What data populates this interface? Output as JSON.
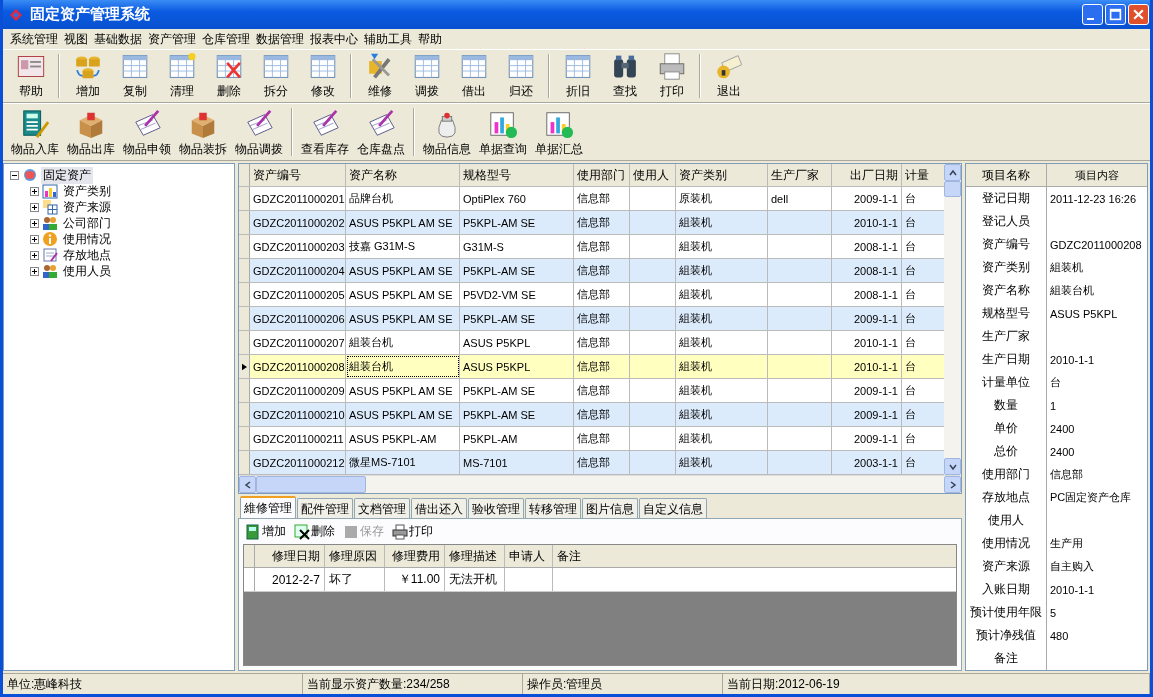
{
  "window": {
    "title": "固定资产管理系统"
  },
  "menu": [
    "系统管理",
    "视图",
    "基础数据",
    "资产管理",
    "仓库管理",
    "数据管理",
    "报表中心",
    "辅助工具",
    "帮助"
  ],
  "toolbar_main": [
    {
      "buttons": [
        "帮助"
      ]
    },
    {
      "buttons": [
        "增加",
        "复制",
        "清理",
        "删除",
        "拆分",
        "修改"
      ]
    },
    {
      "buttons": [
        "维修",
        "调拨",
        "借出",
        "归还"
      ]
    },
    {
      "buttons": [
        "折旧",
        "查找",
        "打印"
      ]
    },
    {
      "buttons": [
        "退出"
      ]
    }
  ],
  "toolbar_goods": [
    {
      "buttons": [
        "物品入库",
        "物品出库",
        "物品申领",
        "物品装拆",
        "物品调拨"
      ]
    },
    {
      "buttons": [
        "查看库存",
        "仓库盘点"
      ]
    },
    {
      "buttons": [
        "物品信息",
        "单据查询",
        "单据汇总"
      ]
    }
  ],
  "tree": [
    {
      "label": "固定资产",
      "expanded": true,
      "selected": true,
      "children": [
        {
          "label": "资产类别",
          "expanded": false,
          "selected": false
        },
        {
          "label": "资产来源",
          "expanded": false,
          "selected": false
        },
        {
          "label": "公司部门",
          "expanded": false,
          "selected": false
        },
        {
          "label": "使用情况",
          "expanded": false,
          "selected": false
        },
        {
          "label": "存放地点",
          "expanded": false,
          "selected": false
        },
        {
          "label": "使用人员",
          "expanded": false,
          "selected": false
        }
      ]
    }
  ],
  "table": {
    "columns": [
      "资产编号",
      "资产名称",
      "规格型号",
      "使用部门",
      "使用人",
      "资产类别",
      "生产厂家",
      "出厂日期",
      "计量"
    ],
    "rows": [
      {
        "selected": false,
        "cells": [
          "GDZC2011000201",
          "品牌台机",
          "OptiPlex 760",
          "信息部",
          "",
          "原装机",
          "dell",
          "2009-1-1",
          "台"
        ]
      },
      {
        "selected": false,
        "cells": [
          "GDZC2011000202",
          "ASUS P5KPL AM SE",
          "P5KPL-AM SE",
          "信息部",
          "",
          "組装机",
          "",
          "2010-1-1",
          "台"
        ]
      },
      {
        "selected": false,
        "cells": [
          "GDZC2011000203",
          "技嘉 G31M-S",
          "G31M-S",
          "信息部",
          "",
          "組装机",
          "",
          "2008-1-1",
          "台"
        ]
      },
      {
        "selected": false,
        "cells": [
          "GDZC2011000204",
          "ASUS P5KPL AM SE",
          "P5KPL-AM SE",
          "信息部",
          "",
          "組装机",
          "",
          "2008-1-1",
          "台"
        ]
      },
      {
        "selected": false,
        "cells": [
          "GDZC2011000205",
          "ASUS P5KPL AM SE",
          "P5VD2-VM SE",
          "信息部",
          "",
          "組装机",
          "",
          "2008-1-1",
          "台"
        ]
      },
      {
        "selected": false,
        "cells": [
          "GDZC2011000206",
          "ASUS P5KPL AM SE",
          "P5KPL-AM SE",
          "信息部",
          "",
          "組装机",
          "",
          "2009-1-1",
          "台"
        ]
      },
      {
        "selected": false,
        "cells": [
          "GDZC2011000207",
          "組装台机",
          "ASUS P5KPL",
          "信息部",
          "",
          "組装机",
          "",
          "2010-1-1",
          "台"
        ]
      },
      {
        "selected": true,
        "cells": [
          "GDZC2011000208",
          "組装台机",
          "ASUS P5KPL",
          "信息部",
          "",
          "組装机",
          "",
          "2010-1-1",
          "台"
        ]
      },
      {
        "selected": false,
        "cells": [
          "GDZC2011000209",
          "ASUS P5KPL AM SE",
          "P5KPL-AM SE",
          "信息部",
          "",
          "組装机",
          "",
          "2009-1-1",
          "台"
        ]
      },
      {
        "selected": false,
        "cells": [
          "GDZC2011000210",
          "ASUS P5KPL AM SE",
          "P5KPL-AM SE",
          "信息部",
          "",
          "組装机",
          "",
          "2009-1-1",
          "台"
        ]
      },
      {
        "selected": false,
        "cells": [
          "GDZC2011000211",
          "ASUS P5KPL-AM",
          "P5KPL-AM",
          "信息部",
          "",
          "組装机",
          "",
          "2009-1-1",
          "台"
        ]
      },
      {
        "selected": false,
        "cells": [
          "GDZC2011000212",
          "微星MS-7101",
          "MS-7101",
          "信息部",
          "",
          "組装机",
          "",
          "2003-1-1",
          "台"
        ]
      }
    ]
  },
  "detail_tabs": [
    {
      "label": "維修管理",
      "selected": true
    },
    {
      "label": "配件管理",
      "selected": false
    },
    {
      "label": "文档管理",
      "selected": false
    },
    {
      "label": "借出还入",
      "selected": false
    },
    {
      "label": "验收管理",
      "selected": false
    },
    {
      "label": "转移管理",
      "selected": false
    },
    {
      "label": "图片信息",
      "selected": false
    },
    {
      "label": "自定义信息",
      "selected": false
    }
  ],
  "detail_toolbar": [
    {
      "label": "增加",
      "disabled": false
    },
    {
      "label": "删除",
      "disabled": false
    },
    {
      "label": "保存",
      "disabled": true
    },
    {
      "label": "打印",
      "disabled": false
    }
  ],
  "repair_table": {
    "columns": [
      "修理日期",
      "修理原因",
      "修理费用",
      "修理描述",
      "申请人",
      "备注"
    ],
    "rows": [
      [
        "2012-2-7",
        "坏了",
        "￥11.00",
        "无法开机",
        "",
        ""
      ]
    ]
  },
  "properties": {
    "columns": [
      "项目名称",
      "项目内容"
    ],
    "rows": [
      [
        "登记日期",
        "2011-12-23 16:26"
      ],
      [
        "登记人员",
        ""
      ],
      [
        "资产编号",
        "GDZC2011000208"
      ],
      [
        "资产类别",
        "組装机"
      ],
      [
        "资产名称",
        "組装台机"
      ],
      [
        "规格型号",
        "ASUS P5KPL"
      ],
      [
        "生产厂家",
        ""
      ],
      [
        "生产日期",
        "2010-1-1"
      ],
      [
        "计量单位",
        "台"
      ],
      [
        "数量",
        "1"
      ],
      [
        "单价",
        "2400"
      ],
      [
        "总价",
        "2400"
      ],
      [
        "使用部门",
        "信息部"
      ],
      [
        "存放地点",
        "PC固定资产仓库"
      ],
      [
        "使用人",
        ""
      ],
      [
        "使用情况",
        "生产用"
      ],
      [
        "资产来源",
        "自主购入"
      ],
      [
        "入账日期",
        "2010-1-1"
      ],
      [
        "预计使用年限",
        "5"
      ],
      [
        "预计净残值",
        "480"
      ],
      [
        "备注",
        ""
      ]
    ]
  },
  "status_bar": [
    "单位:惠峰科技",
    "当前显示资产数量:234/258",
    "操作员:管理员",
    "当前日期:2012-06-19"
  ]
}
